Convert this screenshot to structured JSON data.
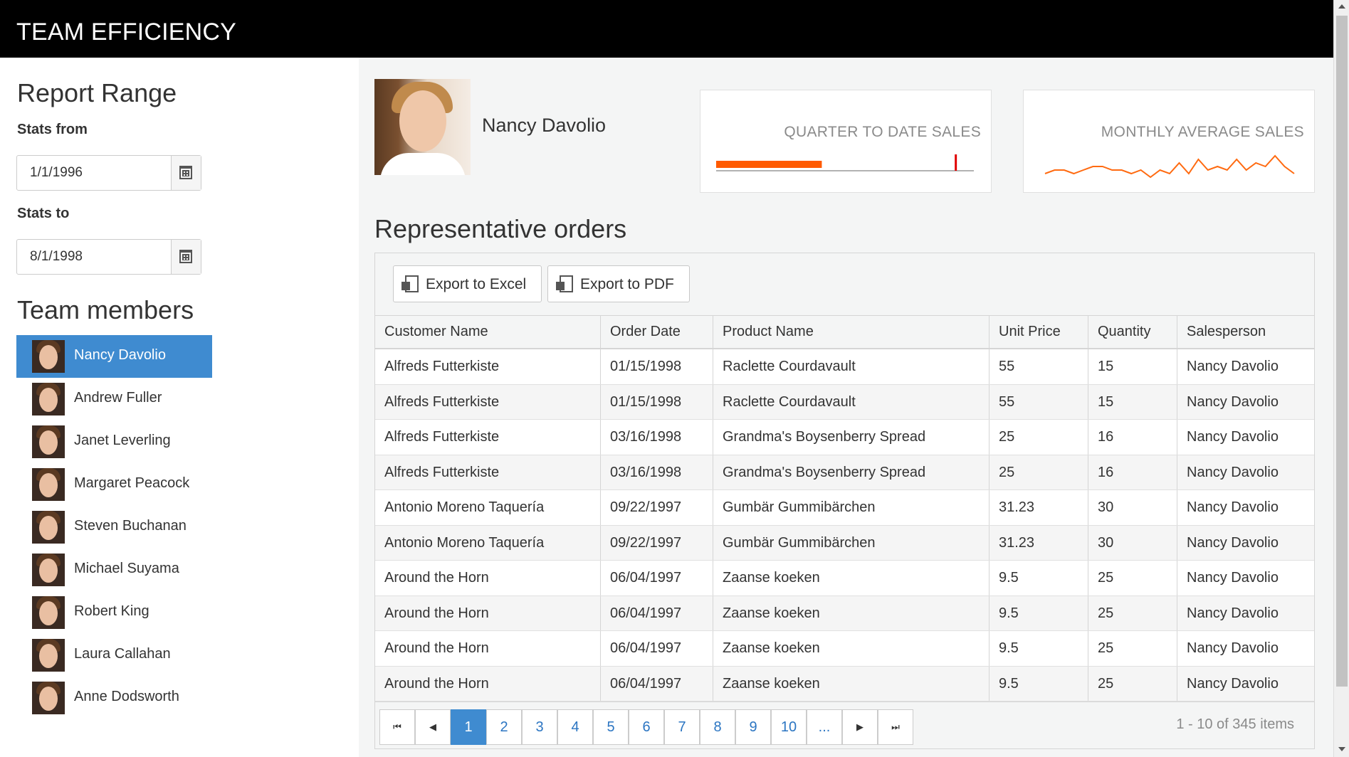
{
  "header": {
    "title": "TEAM EFFICIENCY"
  },
  "sidebar": {
    "report_range_title": "Report Range",
    "stats_from_label": "Stats from",
    "stats_from_value": "1/1/1996",
    "stats_to_label": "Stats to",
    "stats_to_value": "8/1/1998",
    "team_members_title": "Team members",
    "members": [
      {
        "name": "Nancy Davolio",
        "selected": true
      },
      {
        "name": "Andrew Fuller",
        "selected": false
      },
      {
        "name": "Janet Leverling",
        "selected": false
      },
      {
        "name": "Margaret Peacock",
        "selected": false
      },
      {
        "name": "Steven Buchanan",
        "selected": false
      },
      {
        "name": "Michael Suyama",
        "selected": false
      },
      {
        "name": "Robert King",
        "selected": false
      },
      {
        "name": "Laura Callahan",
        "selected": false
      },
      {
        "name": "Anne Dodsworth",
        "selected": false
      }
    ]
  },
  "profile": {
    "name": "Nancy Davolio"
  },
  "stats": {
    "quarter_title": "QUARTER TO DATE SALES",
    "monthly_title": "MONTHLY AVERAGE SALES",
    "quarter_bullet": {
      "value_fraction": 0.41,
      "target_fraction": 0.93,
      "bar_color": "#ff5a00",
      "target_color": "#e00000"
    },
    "monthly_sparkline": {
      "values": [
        5,
        6,
        6,
        5,
        6,
        7,
        7,
        6,
        6,
        5,
        6,
        4,
        6,
        5,
        8,
        5,
        9,
        6,
        7,
        6,
        9,
        6,
        8,
        7,
        10,
        7,
        5
      ],
      "color": "#ff6a10"
    }
  },
  "orders": {
    "title": "Representative orders",
    "export_excel": "Export to Excel",
    "export_pdf": "Export to PDF",
    "columns": [
      "Customer Name",
      "Order Date",
      "Product Name",
      "Unit Price",
      "Quantity",
      "Salesperson"
    ],
    "rows": [
      [
        "Alfreds Futterkiste",
        "01/15/1998",
        "Raclette Courdavault",
        "55",
        "15",
        "Nancy Davolio"
      ],
      [
        "Alfreds Futterkiste",
        "01/15/1998",
        "Raclette Courdavault",
        "55",
        "15",
        "Nancy Davolio"
      ],
      [
        "Alfreds Futterkiste",
        "03/16/1998",
        "Grandma's Boysenberry Spread",
        "25",
        "16",
        "Nancy Davolio"
      ],
      [
        "Alfreds Futterkiste",
        "03/16/1998",
        "Grandma's Boysenberry Spread",
        "25",
        "16",
        "Nancy Davolio"
      ],
      [
        "Antonio Moreno Taquería",
        "09/22/1997",
        "Gumbär Gummibärchen",
        "31.23",
        "30",
        "Nancy Davolio"
      ],
      [
        "Antonio Moreno Taquería",
        "09/22/1997",
        "Gumbär Gummibärchen",
        "31.23",
        "30",
        "Nancy Davolio"
      ],
      [
        "Around the Horn",
        "06/04/1997",
        "Zaanse koeken",
        "9.5",
        "25",
        "Nancy Davolio"
      ],
      [
        "Around the Horn",
        "06/04/1997",
        "Zaanse koeken",
        "9.5",
        "25",
        "Nancy Davolio"
      ],
      [
        "Around the Horn",
        "06/04/1997",
        "Zaanse koeken",
        "9.5",
        "25",
        "Nancy Davolio"
      ],
      [
        "Around the Horn",
        "06/04/1997",
        "Zaanse koeken",
        "9.5",
        "25",
        "Nancy Davolio"
      ]
    ],
    "pager": {
      "pages": [
        "1",
        "2",
        "3",
        "4",
        "5",
        "6",
        "7",
        "8",
        "9",
        "10",
        "..."
      ],
      "current": "1",
      "first_icon": "first-page-icon",
      "prev_icon": "prev-page-icon",
      "next_icon": "next-page-icon",
      "last_icon": "last-page-icon",
      "info": "1 - 10 of 345 items"
    }
  },
  "colors": {
    "accent": "#3f8bd0",
    "header_bg": "#000000",
    "panel_bg": "#f4f5f5"
  }
}
